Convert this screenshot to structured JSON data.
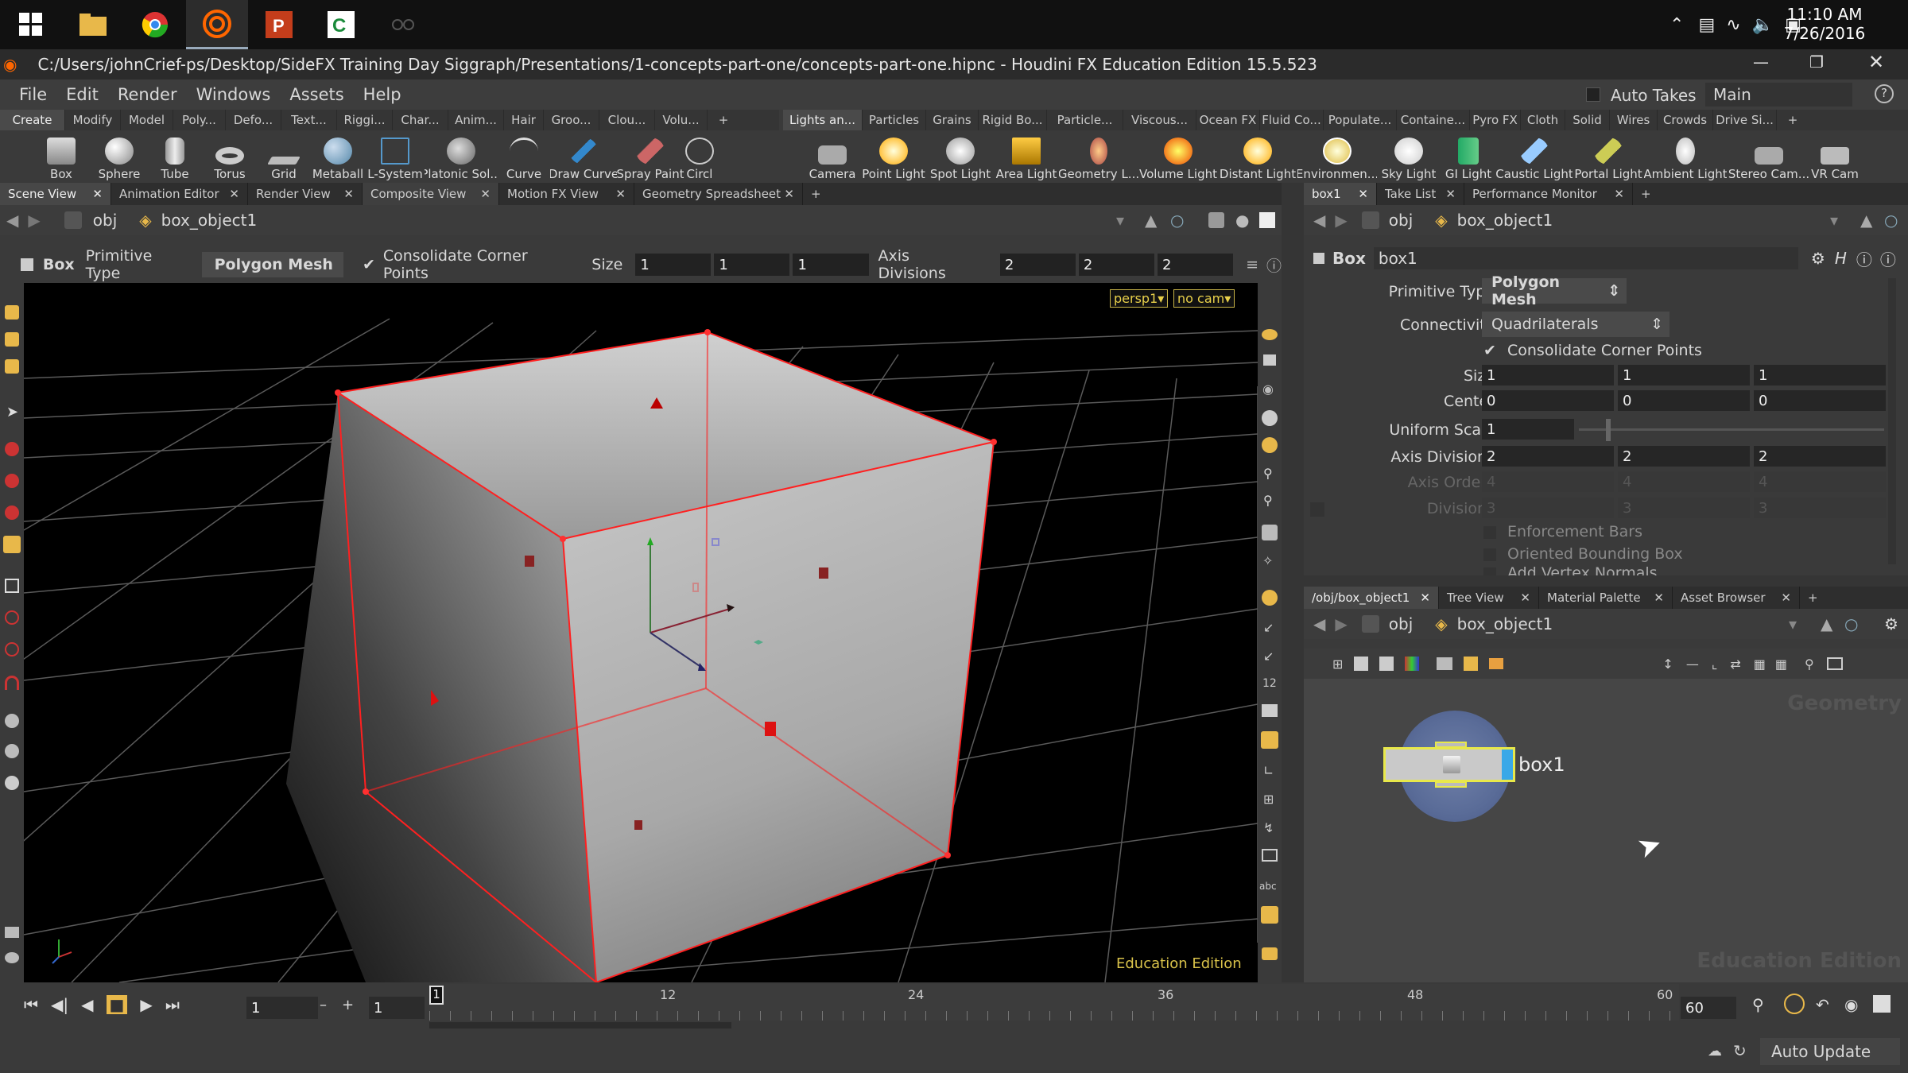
{
  "taskbar": {
    "apps": [
      "windows-start-icon",
      "file-explorer-icon",
      "chrome-icon",
      "houdini-icon",
      "powerpoint-icon",
      "camtasia-icon",
      "pen-icon"
    ],
    "time": "11:10 AM",
    "date": "7/26/2016"
  },
  "window": {
    "title": "C:/Users/johnCrief-ps/Desktop/SideFX Training Day Siggraph/Presentations/1-concepts-part-one/concepts-part-one.hipnc - Houdini FX Education Edition 15.5.523"
  },
  "menu": [
    "File",
    "Edit",
    "Render",
    "Windows",
    "Assets",
    "Help"
  ],
  "desktop": {
    "autotakes": "Auto Takes",
    "name": "Main"
  },
  "shelf_left": {
    "tabs": [
      "Create",
      "Modify",
      "Model",
      "Poly...",
      "Defo...",
      "Text...",
      "Riggi...",
      "Char...",
      "Anim...",
      "Hair",
      "Groo...",
      "Clou...",
      "Volu..."
    ],
    "tools": [
      "Box",
      "Sphere",
      "Tube",
      "Torus",
      "Grid",
      "Metaball",
      "L-System",
      "Platonic Sol...",
      "Curve",
      "Draw Curve",
      "Spray Paint",
      "Circl"
    ]
  },
  "shelf_right": {
    "tabs": [
      "Lights an...",
      "Particles",
      "Grains",
      "Rigid Bo...",
      "Particle...",
      "Viscous...",
      "Ocean FX",
      "Fluid Co...",
      "Populate...",
      "Containe...",
      "Pyro FX",
      "Cloth",
      "Solid",
      "Wires",
      "Crowds",
      "Drive Si..."
    ],
    "tools": [
      "Camera",
      "Point Light",
      "Spot Light",
      "Area Light",
      "Geometry L...",
      "Volume Light",
      "Distant Light",
      "Environmen...",
      "Sky Light",
      "GI Light",
      "Caustic Light",
      "Portal Light",
      "Ambient Light",
      "Stereo Cam...",
      "VR Cam"
    ]
  },
  "left_pane": {
    "tabs": [
      "Scene View",
      "Animation Editor",
      "Render View",
      "Composite View",
      "Motion FX View",
      "Geometry Spreadsheet"
    ],
    "path": {
      "root": "obj",
      "node": "box_object1"
    },
    "options": {
      "node": "Box",
      "primitive_type_label": "Primitive Type",
      "primitive_type": "Polygon Mesh",
      "consolidate": "Consolidate Corner Points",
      "size_label": "Size",
      "size": [
        "1",
        "1",
        "1"
      ],
      "axis_div_label": "Axis Divisions",
      "axis_div": [
        "2",
        "2",
        "2"
      ]
    },
    "viewport": {
      "camera": "persp1▾",
      "cam": "no cam▾",
      "watermark": "Education Edition"
    }
  },
  "param_pane": {
    "tabs": [
      "box1",
      "Take List",
      "Performance Monitor"
    ],
    "path": {
      "root": "obj",
      "node": "box_object1"
    },
    "node_type": "Box",
    "node_name": "box1",
    "params": {
      "primitive_type": {
        "label": "Primitive Type",
        "value": "Polygon Mesh"
      },
      "connectivity": {
        "label": "Connectivity",
        "value": "Quadrilaterals"
      },
      "consolidate": "Consolidate Corner Points",
      "size": {
        "label": "Size",
        "values": [
          "1",
          "1",
          "1"
        ]
      },
      "center": {
        "label": "Center",
        "values": [
          "0",
          "0",
          "0"
        ]
      },
      "uniform_scale": {
        "label": "Uniform Scale",
        "value": "1"
      },
      "axis_divisions": {
        "label": "Axis Divisions",
        "values": [
          "2",
          "2",
          "2"
        ]
      },
      "axis_orders": {
        "label": "Axis Orders",
        "values": [
          "4",
          "4",
          "4"
        ]
      },
      "divisions": {
        "label": "Divisions",
        "values": [
          "3",
          "3",
          "3"
        ]
      },
      "enforcement_bars": "Enforcement Bars",
      "oriented_bbox": "Oriented Bounding Box",
      "add_vertex_normals": "Add Vertex Normals"
    }
  },
  "network_pane": {
    "tabs": [
      "/obj/box_object1",
      "Tree View",
      "Material Palette",
      "Asset Browser"
    ],
    "path": {
      "root": "obj",
      "node": "box_object1"
    },
    "context_label": "Geometry",
    "watermark": "Education Edition",
    "node_label": "box1"
  },
  "timeline": {
    "frame": "1",
    "start": "1",
    "playbar_frame": "1",
    "ticks": [
      "12",
      "24",
      "36",
      "48",
      "60"
    ],
    "end": "60"
  },
  "status": {
    "update_mode": "Auto Update"
  },
  "colors": {
    "selection": "#ff2020",
    "node_highlight": "#e8e84a",
    "accent": "#e8b84a"
  }
}
